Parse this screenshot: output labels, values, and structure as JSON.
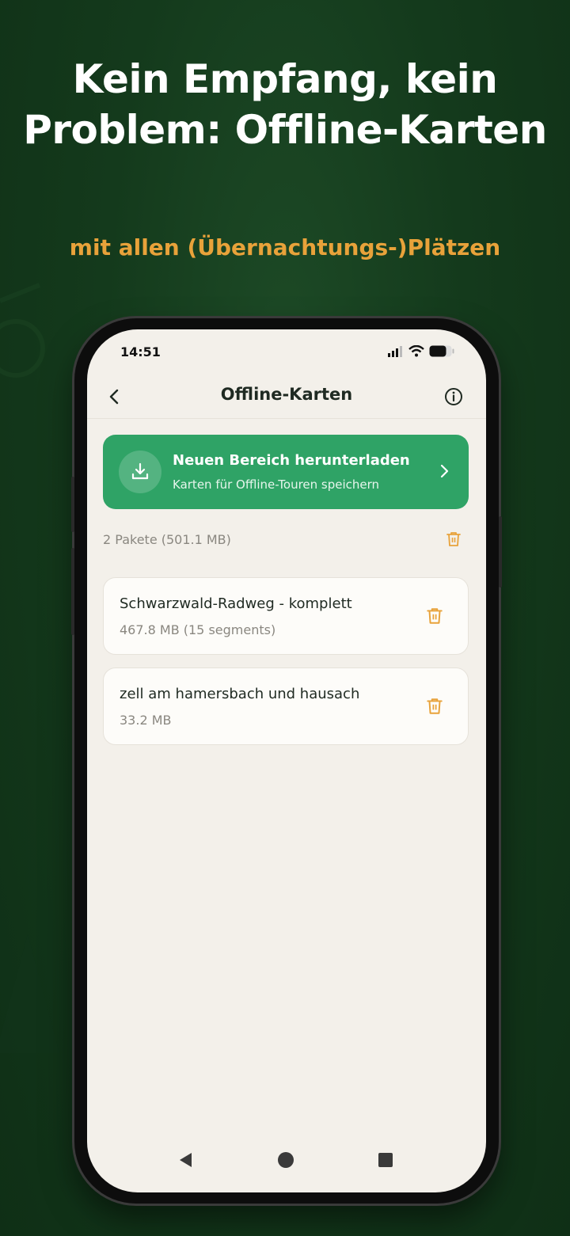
{
  "promo": {
    "headline_line1": "Kein Empfang, kein",
    "headline_line2": "Problem: Offline-Karten",
    "subline": "mit allen (Übernachtungs-)Plätzen"
  },
  "status_bar": {
    "time": "14:51"
  },
  "nav": {
    "title": "Offline-Karten",
    "back_icon": "chevron-left-icon",
    "info_icon": "info-icon"
  },
  "download_card": {
    "title": "Neuen Bereich herunterladen",
    "subtitle": "Karten für Offline-Touren speichern",
    "icon": "download-icon",
    "color": "#2fa366"
  },
  "summary": {
    "text": "2 Pakete (501.1 MB)",
    "trash_icon": "trash-icon"
  },
  "packages": [
    {
      "name": "Schwarzwald-Radweg - komplett",
      "size": "467.8 MB (15 segments)"
    },
    {
      "name": "zell am hamersbach und hausach",
      "size": "33.2 MB"
    }
  ],
  "colors": {
    "background": "#143a1c",
    "accent_orange": "#e8a23a",
    "primary_green": "#2fa366",
    "screen_bg": "#f3f0ea"
  }
}
